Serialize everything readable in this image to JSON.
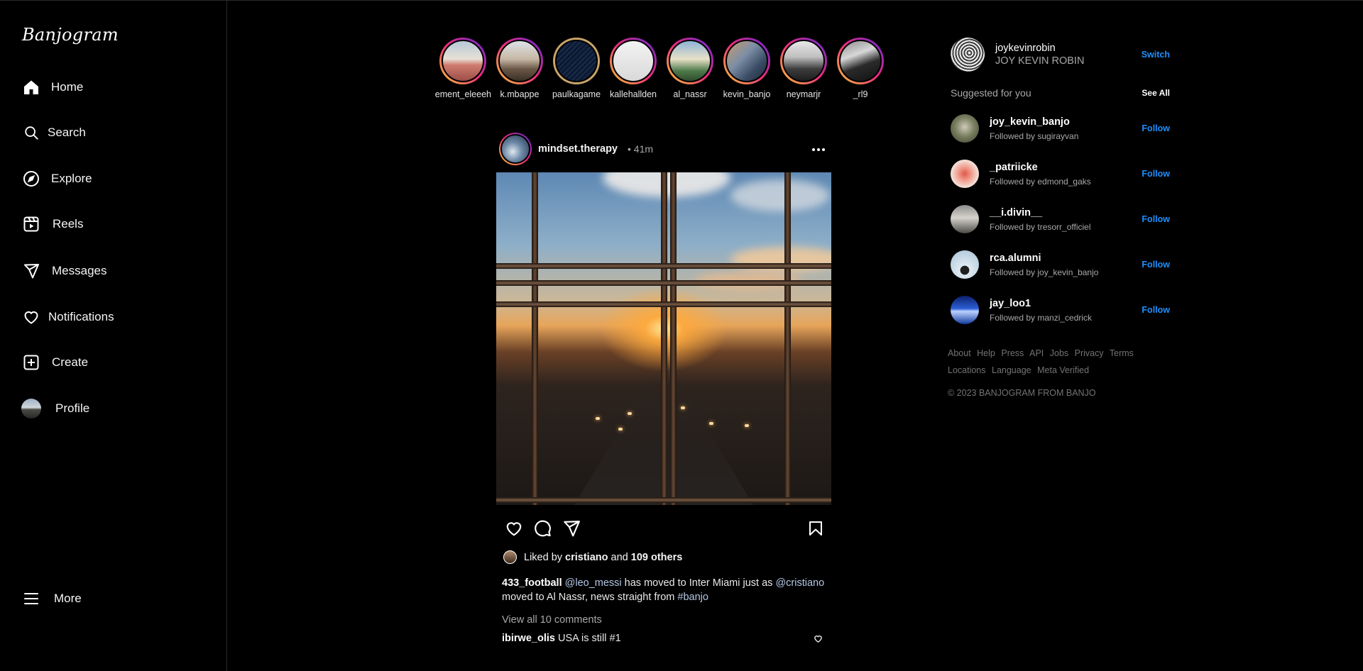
{
  "brand": "Banjogram",
  "nav": [
    {
      "label": "Home",
      "icon": "home-icon"
    },
    {
      "label": "Search",
      "icon": "search-icon"
    },
    {
      "label": "Explore",
      "icon": "compass-icon"
    },
    {
      "label": "Reels",
      "icon": "reels-icon"
    },
    {
      "label": "Messages",
      "icon": "send-icon"
    },
    {
      "label": "Notifications",
      "icon": "heart-icon"
    },
    {
      "label": "Create",
      "icon": "plus-square-icon"
    },
    {
      "label": "Profile",
      "icon": "avatar"
    }
  ],
  "more_label": "More",
  "stories": [
    {
      "username": "element_eleeeh",
      "seen": false
    },
    {
      "username": "k.mbappe",
      "seen": false
    },
    {
      "username": "paulkagame",
      "seen": true
    },
    {
      "username": "kallehallden",
      "seen": false
    },
    {
      "username": "al_nassr",
      "seen": false
    },
    {
      "username": "kevin_banjo",
      "seen": false
    },
    {
      "username": "neymarjr",
      "seen": false
    },
    {
      "username": "_rl9",
      "seen": false
    }
  ],
  "post": {
    "username": "mindset.therapy",
    "time": "• 41m",
    "liked_prefix": "Liked by",
    "liked_user": "cristiano",
    "liked_and": "and",
    "liked_others": "109 others",
    "caption_user": "433_football",
    "caption_mention1": "@leo_messi",
    "caption_text1": "has moved to Inter Miami just as",
    "caption_mention2": "@cristiano",
    "caption_text2": "moved to Al Nassr, news straight from",
    "caption_tag": "#banjo",
    "view_comments": "View all 10 comments",
    "comment_user": "ibirwe_olis",
    "comment_text": "USA is still #1"
  },
  "me": {
    "username": "joykevinrobin",
    "name": "JOY KEVIN ROBIN",
    "switch_label": "Switch"
  },
  "suggestions_title": "Suggested for you",
  "see_all": "See All",
  "suggestions": [
    {
      "username": "joy_kevin_banjo",
      "sub": "Followed by sugirayvan",
      "follow": "Follow"
    },
    {
      "username": "_patriicke",
      "sub": "Followed by edmond_gaks",
      "follow": "Follow"
    },
    {
      "username": "__i.divin__",
      "sub": "Followed by tresorr_officiel",
      "follow": "Follow"
    },
    {
      "username": "rca.alumni",
      "sub": "Followed by joy_kevin_banjo",
      "follow": "Follow"
    },
    {
      "username": "jay_loo1",
      "sub": "Followed by manzi_cedrick",
      "follow": "Follow"
    }
  ],
  "footer_links": [
    "About",
    "Help",
    "Press",
    "API",
    "Jobs",
    "Privacy",
    "Terms",
    "Locations",
    "Language",
    "Meta Verified"
  ],
  "copyright": "© 2023 BANJOGRAM FROM BANJO",
  "colors": {
    "accent": "#1e90ff",
    "background": "#000000",
    "muted": "#a8a8a8"
  }
}
